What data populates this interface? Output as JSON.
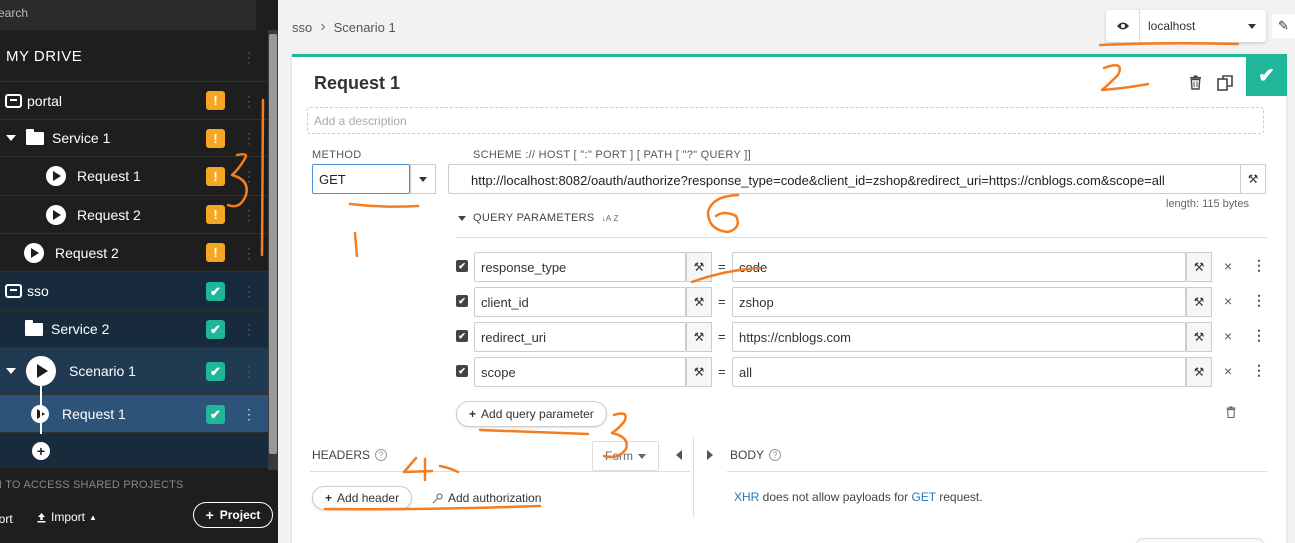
{
  "sidebar": {
    "search_placeholder": "earch",
    "title": "MY DRIVE",
    "items": [
      {
        "label": "portal"
      },
      {
        "label": "Service 1"
      },
      {
        "label": "Request 1"
      },
      {
        "label": "Request 2"
      },
      {
        "label": "Request 2"
      },
      {
        "label": "sso"
      },
      {
        "label": "Service 2"
      },
      {
        "label": "Scenario 1"
      },
      {
        "label": "Request 1"
      }
    ],
    "warn_badge": "!",
    "ok_badge": "✔",
    "kebab": "⋮",
    "add_symbol": "+",
    "shared_text": "N TO ACCESS SHARED PROJECTS",
    "export_label": "port",
    "import_label": "Import",
    "project_label": "Project"
  },
  "breadcrumb": {
    "root": "sso",
    "sep": "›",
    "current": "Scenario 1"
  },
  "environment": {
    "selected": "localhost"
  },
  "request": {
    "title": "Request 1",
    "description_placeholder": "Add a description",
    "method_label": "METHOD",
    "method": "GET",
    "scheme_label": "SCHEME :// HOST [ \":\" PORT ] [ PATH [ \"?\" QUERY ]]",
    "url": "http://localhost:8082/oauth/authorize?response_type=code&client_id=zshop&redirect_uri=https://cnblogs.com&scope=all",
    "length": "length: 115 bytes",
    "query_params_label": "QUERY PARAMETERS",
    "sort_icon": "↓A Z",
    "query_params": [
      {
        "name": "response_type",
        "value": "code"
      },
      {
        "name": "client_id",
        "value": "zshop"
      },
      {
        "name": "redirect_uri",
        "value": "https://cnblogs.com"
      },
      {
        "name": "scope",
        "value": "all"
      }
    ],
    "eq": "=",
    "remove_symbol": "×",
    "check_symbol": "✔",
    "add_query_label": "Add query parameter",
    "headers_label": "HEADERS",
    "form_label": "Form",
    "body_label": "BODY",
    "add_header_label": "Add header",
    "add_auth_label": "Add authorization",
    "xhr_note": {
      "a": "XHR",
      "b": " does not allow payloads for ",
      "c": "GET",
      "d": " request."
    }
  },
  "colors": {
    "accent": "#20b69a",
    "warn": "#f5a623",
    "annotation": "#f57c1f"
  }
}
